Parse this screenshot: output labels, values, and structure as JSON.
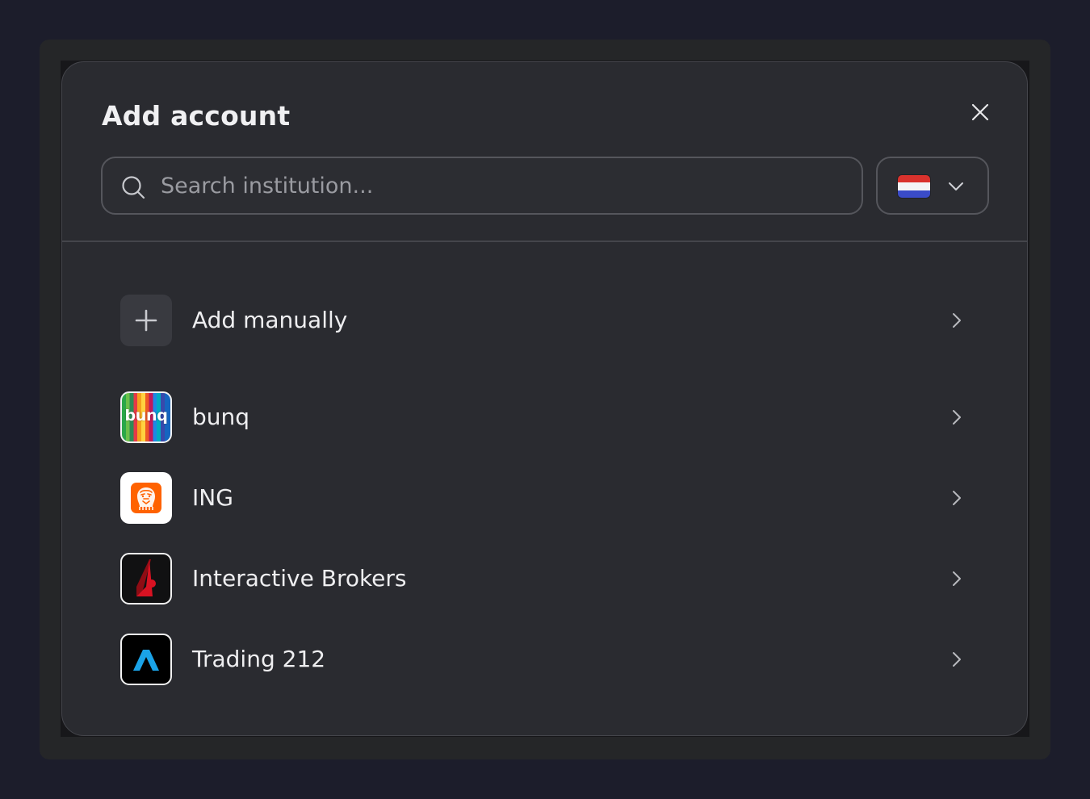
{
  "modal": {
    "title": "Add account",
    "close_icon": "close-icon"
  },
  "search": {
    "placeholder": "Search institution...",
    "value": "",
    "icon": "search-icon"
  },
  "country_selector": {
    "selected": "Netherlands",
    "flag_colors": [
      "#d9322d",
      "#f4f4f6",
      "#3a4bc8"
    ],
    "icon": "chevron-down-icon"
  },
  "institutions": [
    {
      "label": "Add manually",
      "icon": "plus-icon"
    },
    {
      "label": "bunq",
      "logo": "bunq-logo",
      "logo_text": "bunq"
    },
    {
      "label": "ING",
      "logo": "ing-lion-logo"
    },
    {
      "label": "Interactive Brokers",
      "logo": "interactive-brokers-logo"
    },
    {
      "label": "Trading 212",
      "logo": "trading-212-logo"
    }
  ],
  "colors": {
    "page_background": "#1c1d2b",
    "modal_background": "#2a2b30",
    "text_primary": "#eeeef0",
    "border": "#55565c",
    "ing_orange": "#ff6200",
    "ib_red": "#d81222",
    "t212_blue": "#1aa3e8"
  }
}
